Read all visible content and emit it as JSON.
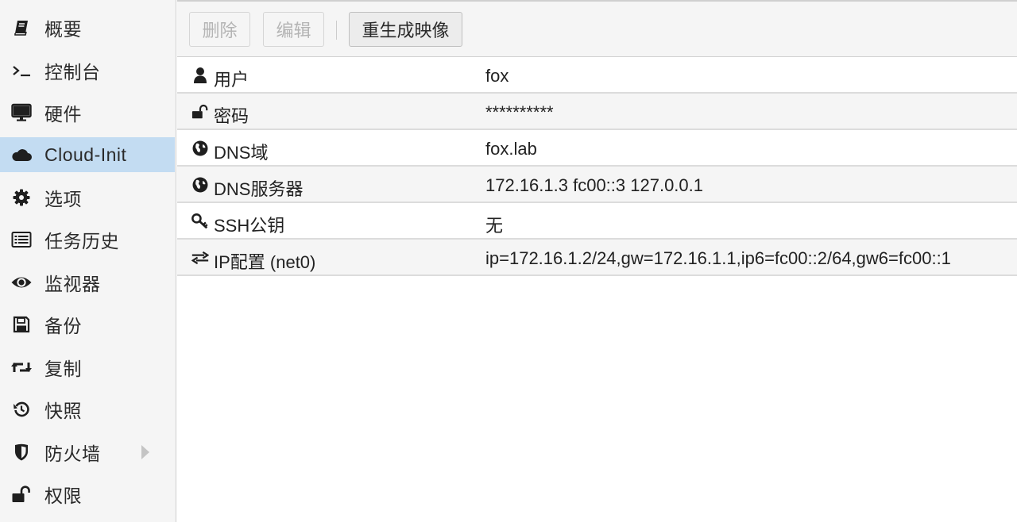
{
  "sidebar": {
    "items": [
      {
        "label": "概要",
        "icon": "book-icon",
        "active": false
      },
      {
        "label": "控制台",
        "icon": "terminal-icon",
        "active": false
      },
      {
        "label": "硬件",
        "icon": "desktop-icon",
        "active": false
      },
      {
        "label": "Cloud-Init",
        "icon": "cloud-icon",
        "active": true
      },
      {
        "label": "选项",
        "icon": "gear-icon",
        "active": false
      },
      {
        "label": "任务历史",
        "icon": "list-icon",
        "active": false
      },
      {
        "label": "监视器",
        "icon": "eye-icon",
        "active": false
      },
      {
        "label": "备份",
        "icon": "floppy-icon",
        "active": false
      },
      {
        "label": "复制",
        "icon": "retweet-icon",
        "active": false
      },
      {
        "label": "快照",
        "icon": "history-icon",
        "active": false
      },
      {
        "label": "防火墙",
        "icon": "shield-icon",
        "active": false,
        "expandable": true
      },
      {
        "label": "权限",
        "icon": "unlock-icon",
        "active": false
      }
    ]
  },
  "toolbar": {
    "delete_label": "删除",
    "edit_label": "编辑",
    "regenerate_label": "重生成映像"
  },
  "cloudinit": {
    "rows": [
      {
        "key": "用户",
        "icon": "user-icon",
        "value": "fox"
      },
      {
        "key": "密码",
        "icon": "unlock-icon",
        "value": "**********"
      },
      {
        "key": "DNS域",
        "icon": "globe-icon",
        "value": "fox.lab"
      },
      {
        "key": "DNS服务器",
        "icon": "globe-icon",
        "value": "172.16.1.3 fc00::3 127.0.0.1"
      },
      {
        "key": "SSH公钥",
        "icon": "key-icon",
        "value": "无"
      },
      {
        "key": "IP配置 (net0)",
        "icon": "exchange-icon",
        "value": "ip=172.16.1.2/24,gw=172.16.1.1,ip6=fc00::2/64,gw6=fc00::1"
      }
    ]
  },
  "colors": {
    "active_bg": "#c3dcf2",
    "sidebar_bg": "#f5f5f5",
    "border": "#d0d0d0"
  }
}
